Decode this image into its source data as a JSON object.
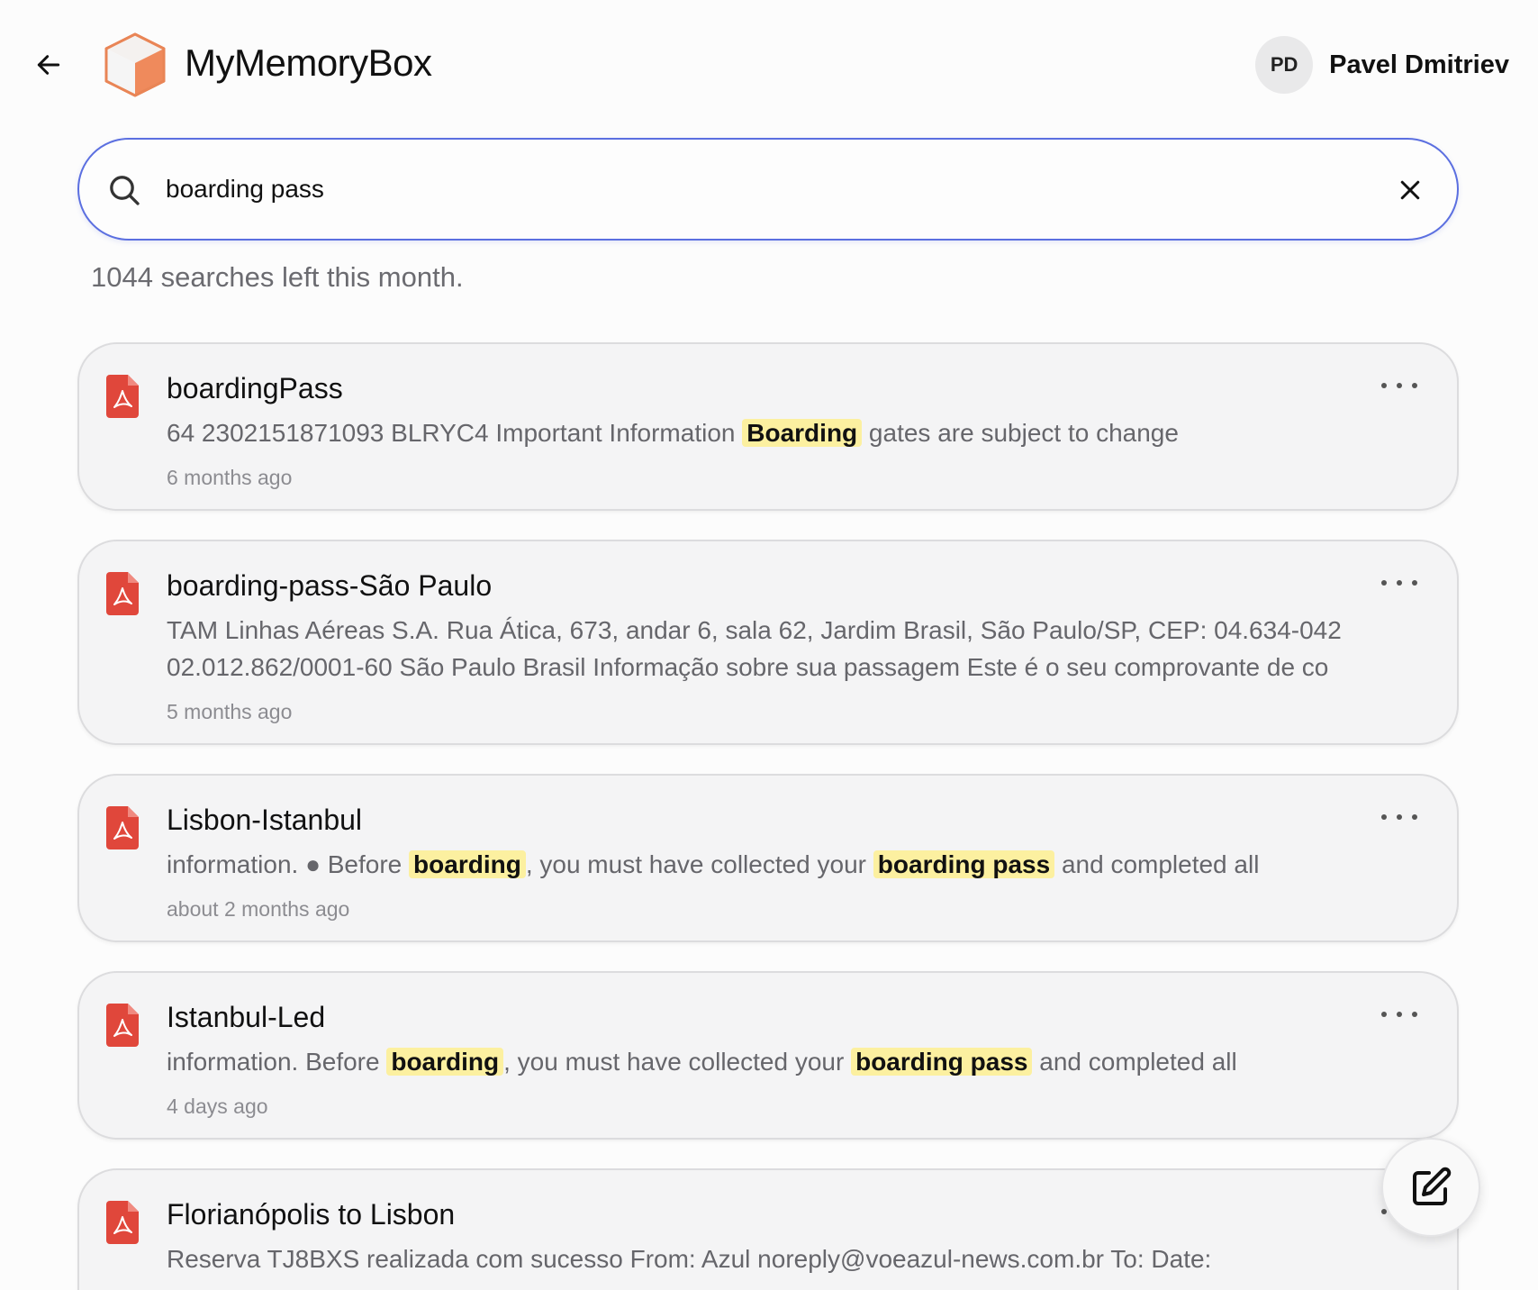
{
  "header": {
    "title": "MyMemoryBox",
    "user": {
      "initials": "PD",
      "name": "Pavel Dmitriev"
    }
  },
  "search": {
    "value": "boarding pass",
    "quota_text": "1044 searches left this month."
  },
  "results": [
    {
      "title": "boardingPass",
      "snippet_parts": [
        {
          "text": "64 2302151871093 BLRYC4 Important Information ",
          "hl": false
        },
        {
          "text": "Boarding",
          "hl": true
        },
        {
          "text": " gates are subject to change",
          "hl": false
        }
      ],
      "date": "6 months ago"
    },
    {
      "title": "boarding-pass-São Paulo",
      "snippet_parts": [
        {
          "text": "TAM Linhas Aéreas S.A. Rua Ática, 673, andar 6, sala 62, Jardim Brasil, São Paulo/SP, CEP: 04.634-042\n02.012.862/0001-60 São Paulo Brasil Informação sobre sua passagem Este é o seu comprovante de co",
          "hl": false
        }
      ],
      "date": "5 months ago"
    },
    {
      "title": "Lisbon-Istanbul",
      "snippet_parts": [
        {
          "text": "information. ● Before ",
          "hl": false
        },
        {
          "text": "boarding",
          "hl": true
        },
        {
          "text": ", you must have collected your ",
          "hl": false
        },
        {
          "text": "boarding pass",
          "hl": true
        },
        {
          "text": " and completed all",
          "hl": false
        }
      ],
      "date": "about 2 months ago"
    },
    {
      "title": "Istanbul-Led",
      "snippet_parts": [
        {
          "text": "information. Before ",
          "hl": false
        },
        {
          "text": "boarding",
          "hl": true
        },
        {
          "text": ", you must have collected your ",
          "hl": false
        },
        {
          "text": "boarding pass",
          "hl": true
        },
        {
          "text": " and completed all",
          "hl": false
        }
      ],
      "date": "4 days ago"
    },
    {
      "title": "Florianópolis to Lisbon",
      "snippet_parts": [
        {
          "text": "Reserva TJ8BXS realizada com sucesso From: Azul noreply@voeazul-news.com.br To: Date:",
          "hl": false
        }
      ],
      "date": ""
    }
  ],
  "icons": {
    "back": "arrow-left-icon",
    "logo": "cube-logo-icon",
    "search": "search-icon",
    "clear": "close-icon",
    "file": "pdf-file-icon",
    "more": "more-horizontal-icon",
    "compose": "edit-icon"
  },
  "colors": {
    "accent": "#5b6fe0",
    "highlight": "#fcf0a0",
    "pdf_red": "#e0473b",
    "logo_orange": "#ef8a5c"
  }
}
